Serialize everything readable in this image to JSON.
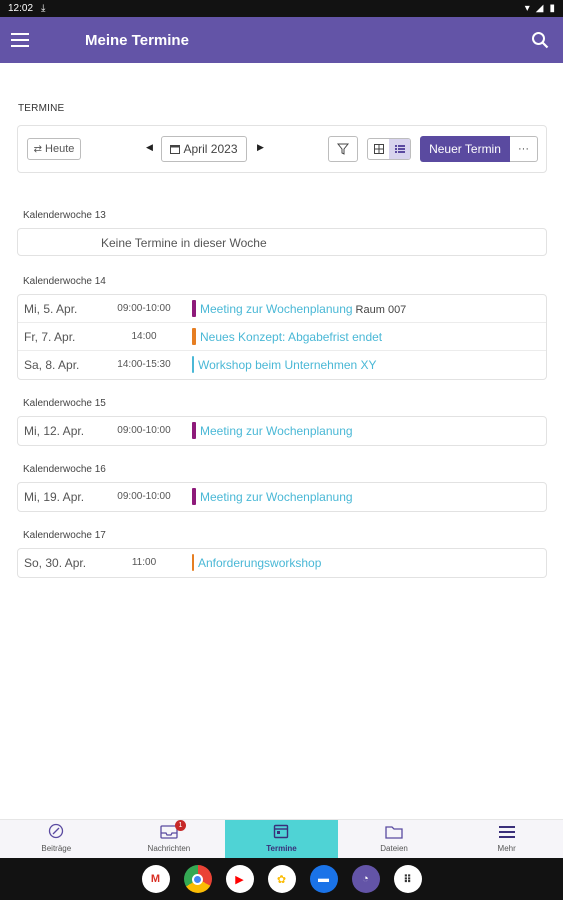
{
  "status": {
    "time": "12:02"
  },
  "appbar": {
    "title": "Meine Termine"
  },
  "section_label": "TERMINE",
  "toolbar": {
    "today_label": "Heute",
    "month_label": "April 2023",
    "new_label": "Neuer Termin",
    "more_label": "···"
  },
  "weeks": [
    {
      "label": "Kalenderwoche 13",
      "empty_text": "Keine Termine in dieser Woche"
    },
    {
      "label": "Kalenderwoche 14",
      "events": [
        {
          "date": "Mi, 5. Apr.",
          "time": "09:00-10:00",
          "title": "Meeting zur Wochenplanung",
          "room": "Raum 007",
          "color": "#8e1a7a"
        },
        {
          "date": "Fr, 7. Apr.",
          "time": "14:00",
          "title": "Neues Konzept: Abgabefrist endet",
          "color": "#e67e22"
        },
        {
          "date": "Sa, 8. Apr.",
          "time": "14:00-15:30",
          "title": "Workshop beim Unternehmen XY",
          "color": "#4ab8d6"
        }
      ]
    },
    {
      "label": "Kalenderwoche 15",
      "events": [
        {
          "date": "Mi, 12. Apr.",
          "time": "09:00-10:00",
          "title": "Meeting zur Wochenplanung",
          "color": "#8e1a7a"
        }
      ]
    },
    {
      "label": "Kalenderwoche 16",
      "events": [
        {
          "date": "Mi, 19. Apr.",
          "time": "09:00-10:00",
          "title": "Meeting zur Wochenplanung",
          "color": "#8e1a7a"
        }
      ]
    },
    {
      "label": "Kalenderwoche 17",
      "events": [
        {
          "date": "So, 30. Apr.",
          "time": "11:00",
          "title": "Anforderungsworkshop",
          "color": "#e67e22"
        }
      ]
    }
  ],
  "nav": {
    "posts": "Beiträge",
    "messages": "Nachrichten",
    "messages_badge": "1",
    "appointments": "Termine",
    "files": "Dateien",
    "more": "Mehr"
  },
  "colors": {
    "primary": "#6354a7",
    "active_tab": "#4fd3d5",
    "event_link": "#4ab8d6"
  },
  "dock_apps": [
    "gmail-icon",
    "chrome-icon",
    "youtube-icon",
    "photos-icon",
    "messages-icon",
    "assistant-icon",
    "app-drawer-icon"
  ]
}
